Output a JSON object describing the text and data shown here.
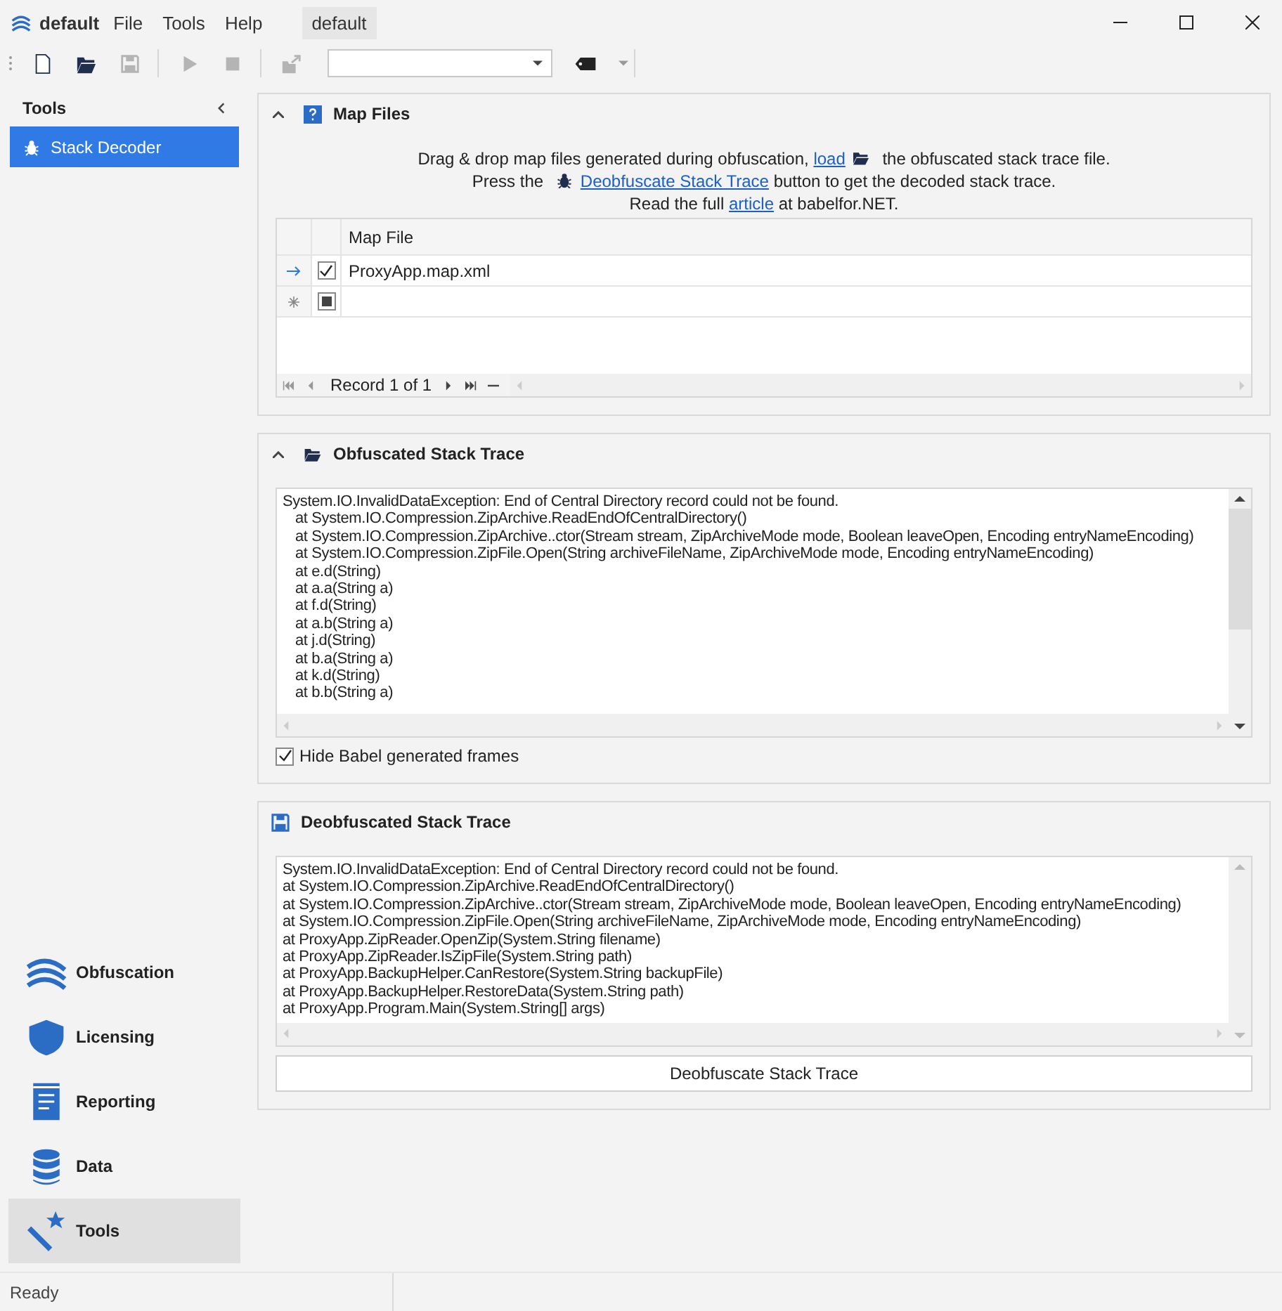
{
  "app": {
    "title": "default",
    "menu": [
      "File",
      "Tools",
      "Help"
    ],
    "document_tab": {
      "label": "default",
      "selected": true
    }
  },
  "toolbar": {
    "buttons": [
      {
        "kind": "new",
        "disabled": false
      },
      {
        "kind": "open",
        "disabled": false
      },
      {
        "kind": "save",
        "disabled": true
      },
      {
        "kind": "run",
        "disabled": true
      },
      {
        "kind": "stop",
        "disabled": true
      },
      {
        "kind": "export",
        "disabled": true
      }
    ],
    "tag_dropdown": {
      "disabled": false
    }
  },
  "sidebar": {
    "title": "Tools",
    "items": [
      {
        "label": "Stack Decoder",
        "selected": true
      }
    ],
    "nav": [
      {
        "kind": "obfuscation",
        "label": "Obfuscation",
        "selected": false
      },
      {
        "kind": "licensing",
        "label": "Licensing",
        "selected": false
      },
      {
        "kind": "reporting",
        "label": "Reporting",
        "selected": false
      },
      {
        "kind": "data",
        "label": "Data",
        "selected": false
      },
      {
        "kind": "tools",
        "label": "Tools",
        "selected": true
      }
    ]
  },
  "map_files": {
    "title": "Map Files",
    "expanded": true,
    "hint": [
      [
        {
          "kind": "text",
          "text": "Drag & drop map files generated during obfuscation, "
        },
        {
          "kind": "link",
          "text": "load"
        },
        {
          "kind": "folder"
        },
        {
          "kind": "text",
          "text": " the obfuscated stack trace file."
        }
      ],
      [
        {
          "kind": "text",
          "text": "Press the "
        },
        {
          "kind": "bug"
        },
        {
          "kind": "link",
          "text": "Deobfuscate Stack Trace"
        },
        {
          "kind": "text",
          "text": " button to get the decoded stack trace."
        }
      ],
      [
        {
          "kind": "text",
          "text": "Read the full "
        },
        {
          "kind": "link",
          "text": "article"
        },
        {
          "kind": "text",
          "text": " at babelfor.NET."
        }
      ]
    ],
    "columns": [
      "Map File"
    ],
    "rows": [
      {
        "kind": "record",
        "checked": true,
        "map_file": "ProxyApp.map.xml"
      },
      {
        "kind": "new_row",
        "checked": false
      }
    ],
    "navigator": "Record 1 of 1"
  },
  "obfuscated": {
    "title": "Obfuscated Stack Trace",
    "expanded": true,
    "lines": [
      {
        "text": "System.IO.InvalidDataException: End of Central Directory record could not be found.",
        "indent": false
      },
      {
        "text": "at System.IO.Compression.ZipArchive.ReadEndOfCentralDirectory()",
        "indent": true
      },
      {
        "text": "at System.IO.Compression.ZipArchive..ctor(Stream stream, ZipArchiveMode mode, Boolean leaveOpen, Encoding entryNameEncoding)",
        "indent": true
      },
      {
        "text": "at System.IO.Compression.ZipFile.Open(String archiveFileName, ZipArchiveMode mode, Encoding entryNameEncoding)",
        "indent": true
      },
      {
        "text": "at e.d(String)",
        "indent": true
      },
      {
        "text": "at a.a(String a)",
        "indent": true
      },
      {
        "text": "at f.d(String)",
        "indent": true
      },
      {
        "text": "at a.b(String a)",
        "indent": true
      },
      {
        "text": "at j.d(String)",
        "indent": true
      },
      {
        "text": "at b.a(String a)",
        "indent": true
      },
      {
        "text": "at k.d(String)",
        "indent": true
      },
      {
        "text": "at b.b(String a)",
        "indent": true
      }
    ],
    "hide_frames": {
      "label": "Hide Babel generated frames",
      "checked": true
    }
  },
  "deobfuscated": {
    "title": "Deobfuscated Stack Trace",
    "lines": [
      "System.IO.InvalidDataException: End of Central Directory record could not be found.",
      "at System.IO.Compression.ZipArchive.ReadEndOfCentralDirectory()",
      "at System.IO.Compression.ZipArchive..ctor(Stream stream, ZipArchiveMode mode, Boolean leaveOpen, Encoding entryNameEncoding)",
      "at System.IO.Compression.ZipFile.Open(String archiveFileName, ZipArchiveMode mode, Encoding entryNameEncoding)",
      "at ProxyApp.ZipReader.OpenZip(System.String filename)",
      "at ProxyApp.ZipReader.IsZipFile(System.String path)",
      "at ProxyApp.BackupHelper.CanRestore(System.String backupFile)",
      "at ProxyApp.BackupHelper.RestoreData(System.String path)",
      "at ProxyApp.Program.Main(System.String[] args)"
    ],
    "button": "Deobfuscate Stack Trace"
  },
  "status_bar": {
    "text": "Ready"
  }
}
